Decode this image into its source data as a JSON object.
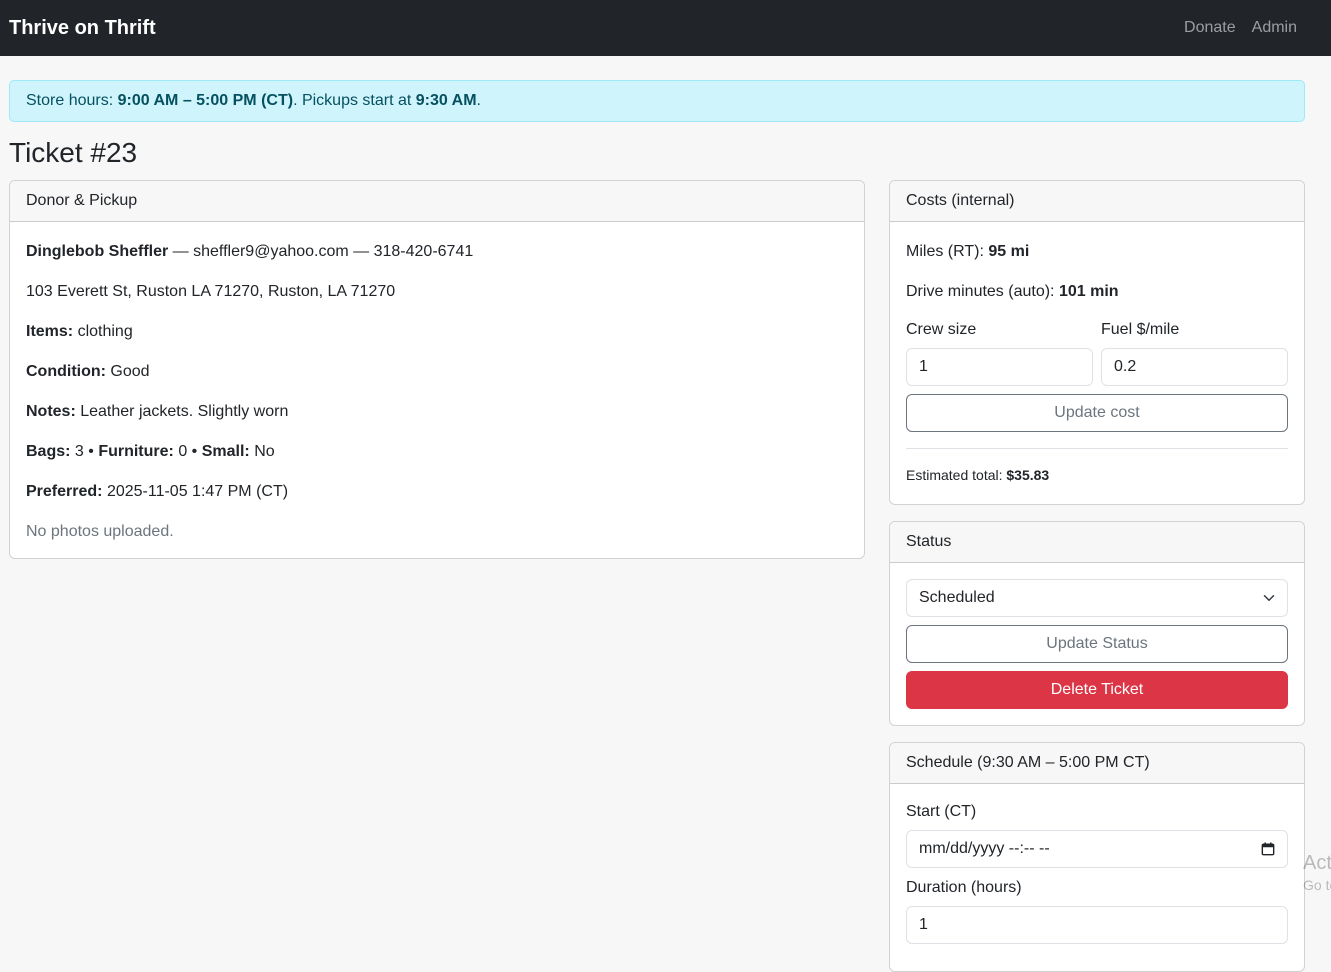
{
  "nav": {
    "brand": "Thrive on Thrift",
    "links": [
      "Donate",
      "Admin"
    ]
  },
  "alert": {
    "prefix": "Store hours: ",
    "hours": "9:00 AM – 5:00 PM (CT)",
    "middle": ". Pickups start at ",
    "pickup_start": "9:30 AM",
    "suffix": "."
  },
  "page_title": "Ticket #23",
  "donor": {
    "header": "Donor & Pickup",
    "name": "Dinglebob Sheffler",
    "contact_sep": " — ",
    "email": "sheffler9@yahoo.com",
    "phone": "318-420-6741",
    "address": "103 Everett St, Ruston LA 71270, Ruston, LA 71270",
    "items_label": "Items:",
    "items": "clothing",
    "condition_label": "Condition:",
    "condition": "Good",
    "notes_label": "Notes:",
    "notes": "Leather jackets. Slightly worn",
    "bags_label": "Bags:",
    "bags": "3",
    "furniture_label": "Furniture:",
    "furniture": "0",
    "small_label": "Small:",
    "small": "No",
    "bullet": " • ",
    "preferred_label": "Preferred:",
    "preferred": "2025-11-05 1:47 PM (CT)",
    "photos": "No photos uploaded."
  },
  "costs": {
    "header": "Costs (internal)",
    "miles_label": "Miles (RT):",
    "miles": "95 mi",
    "drive_label": "Drive minutes (auto):",
    "drive": "101 min",
    "crew_label": "Crew size",
    "crew_value": "1",
    "fuel_label": "Fuel $/mile",
    "fuel_value": "0.2",
    "update_button": "Update cost",
    "total_label": "Estimated total:",
    "total": "$35.83"
  },
  "status": {
    "header": "Status",
    "selected": "Scheduled",
    "update_button": "Update Status",
    "delete_button": "Delete Ticket"
  },
  "schedule": {
    "header": "Schedule (9:30 AM – 5:00 PM CT)",
    "start_label": "Start (CT)",
    "start_placeholder": "mm/dd/yyyy --:-- --",
    "duration_label": "Duration (hours)",
    "duration_value": "1"
  },
  "watermark": {
    "line1": "Activate Windows",
    "line2": "Go to Settings to activate Windows."
  }
}
